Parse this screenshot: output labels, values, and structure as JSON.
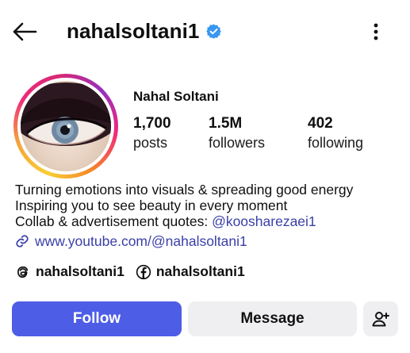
{
  "header": {
    "username": "nahalsoltani1",
    "back_icon": "back-arrow-icon",
    "verified_icon": "verified-badge-icon",
    "more_icon": "more-vertical-icon",
    "verified_color": "#3897f0"
  },
  "profile": {
    "full_name": "Nahal Soltani",
    "avatar": "profile-photo-eye",
    "story_ring_colors": [
      "#f9ce34",
      "#ee2a7b",
      "#962fbf"
    ],
    "stats": [
      {
        "value": "1,700",
        "label": "posts"
      },
      {
        "value": "1.5M",
        "label": "followers"
      },
      {
        "value": "402",
        "label": "following"
      }
    ]
  },
  "bio": {
    "line1": "Turning emotions into visuals & spreading good energy",
    "line2": "Inspiring you to see beauty in every moment",
    "line3_prefix": "Collab & advertisement quotes: ",
    "line3_mention": "@koosharezaei1",
    "link_icon": "link-icon",
    "link": "www.youtube.com/@nahalsoltani1",
    "mention_color": "#3a3fa8"
  },
  "socials": [
    {
      "icon": "threads-icon",
      "handle": "nahalsoltani1"
    },
    {
      "icon": "facebook-icon",
      "handle": "nahalsoltani1"
    }
  ],
  "actions": {
    "follow_label": "Follow",
    "message_label": "Message",
    "add_person_icon": "add-person-icon",
    "follow_color": "#4e5de6",
    "secondary_color": "#efeff2"
  }
}
